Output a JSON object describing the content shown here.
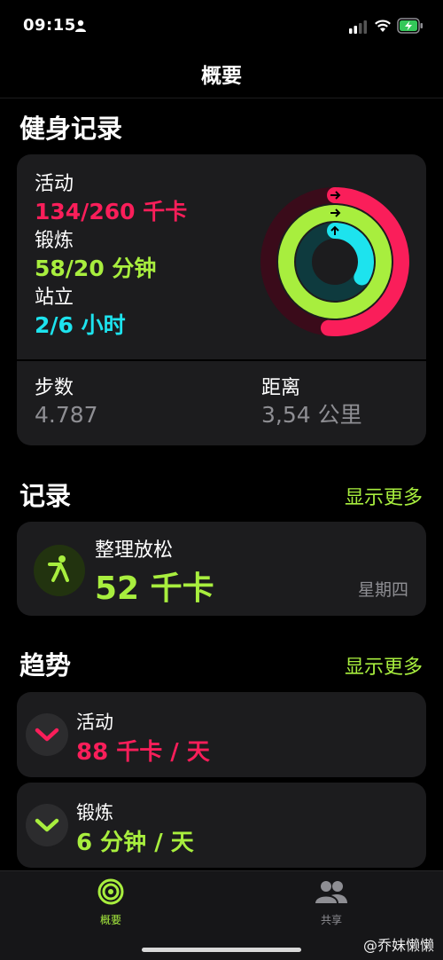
{
  "status_bar": {
    "time": "09:15"
  },
  "nav": {
    "title": "概要"
  },
  "fitness": {
    "title": "健身记录",
    "move": {
      "label": "活动",
      "value": "134/260 千卡",
      "fraction": 0.515
    },
    "exercise": {
      "label": "锻炼",
      "value": "58/20 分钟",
      "fraction": 2.9
    },
    "stand": {
      "label": "站立",
      "value": "2/6 小时",
      "fraction": 0.333
    },
    "steps": {
      "label": "步数",
      "value": "4.787"
    },
    "distance": {
      "label": "距离",
      "value": "3,54 公里"
    }
  },
  "records": {
    "title": "记录",
    "show_more": "显示更多",
    "item": {
      "name": "整理放松",
      "value": "52 千卡",
      "day": "星期四"
    }
  },
  "trends": {
    "title": "趋势",
    "show_more": "显示更多",
    "items": [
      {
        "name": "活动",
        "value": "88 千卡 / 天",
        "color": "#fa1e5a"
      },
      {
        "name": "锻炼",
        "value": "6 分钟 / 天",
        "color": "#a8ee3e"
      }
    ]
  },
  "tab_bar": {
    "tabs": [
      {
        "label": "概要",
        "active": true
      },
      {
        "label": "共享",
        "active": false
      }
    ]
  },
  "watermark": "@乔妹懒懒",
  "colors": {
    "move": "#fa1e5a",
    "exercise": "#a8ee3e",
    "stand": "#1de3ee",
    "accent": "#a8ee3e"
  }
}
